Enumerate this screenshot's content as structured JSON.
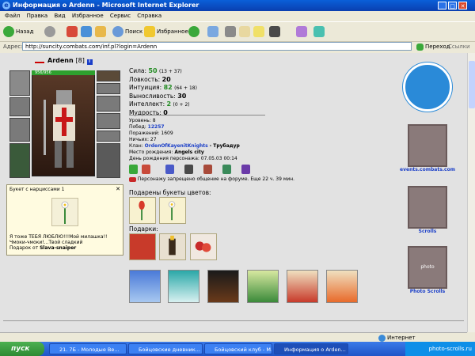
{
  "window": {
    "title": "Информация о Ardenn - Microsoft Internet Explorer",
    "min_glyph": "_",
    "max_glyph": "□",
    "close_glyph": "✕"
  },
  "menu": [
    "Файл",
    "Правка",
    "Вид",
    "Избранное",
    "Сервис",
    "Справка"
  ],
  "toolbar": {
    "back": "Назад",
    "search": "Поиск",
    "favorites": "Избранное"
  },
  "address": {
    "label": "Адрес:",
    "url": "http://suncity.combats.com/inf.pl?login=Ardenn",
    "go": "Переход",
    "links": "Ссылки"
  },
  "character": {
    "name": "Ardenn",
    "level_tag": "[8]",
    "hp": "956/956"
  },
  "stats": {
    "strength_label": "Сила:",
    "strength": "50",
    "strength_bonus": "(13 + 37)",
    "agility_label": "Ловкость:",
    "agility": "20",
    "intuition_label": "Интуиция:",
    "intuition": "82",
    "intuition_bonus": "(64 + 18)",
    "endurance_label": "Выносливость:",
    "endurance": "30",
    "intellect_label": "Интеллект:",
    "intellect": "2",
    "intellect_bonus": "(0 + 2)",
    "wisdom_label": "Мудрость:",
    "wisdom": "0"
  },
  "info": {
    "level": "Уровень: 8",
    "wins_label": "Побед:",
    "wins": "12257",
    "losses": "Поражений: 1609",
    "draws": "Ничьих: 27",
    "clan_label": "Клан:",
    "clan": "OrdenOfKayenitKnights",
    "clan_rank": "- Трубадур",
    "birthplace_label": "Место рождения:",
    "birthplace": "Angels city",
    "birthday": "День рождения персонажа: 07.05.03 00:14"
  },
  "forum_notice": "Персонажу запрещено общение на форуме. Еще 22 ч. 39 мин.",
  "popup": {
    "title": "Букет с нарциссами 1",
    "close": "✕",
    "line1": "Я тоже ТЕБЯ ЛЮБЛЮ!!!Мой милашка!!",
    "line2": "Чмоки-чмоки!...Твой сладкий",
    "from_label": "Подарок от",
    "from": "Slava-snaiper"
  },
  "sections": {
    "flowers": "Подарены букеты цветов:",
    "gifts": "Подарки:"
  },
  "sidebar": {
    "events_label": "events.combats.com",
    "scrolls_label": "Scrolls",
    "photo_label": "Photo Scrolls",
    "photo_word": "photo"
  },
  "status": {
    "zone": "Интернет"
  },
  "taskbar": {
    "start": "пуск",
    "tasks": [
      "21. 7Б - Молодые Ве...",
      "Бойцовские дневник...",
      "Бойцовский клуб - М...",
      "Информация о Arden..."
    ],
    "tray_text": "photo-scrolls.ru"
  }
}
